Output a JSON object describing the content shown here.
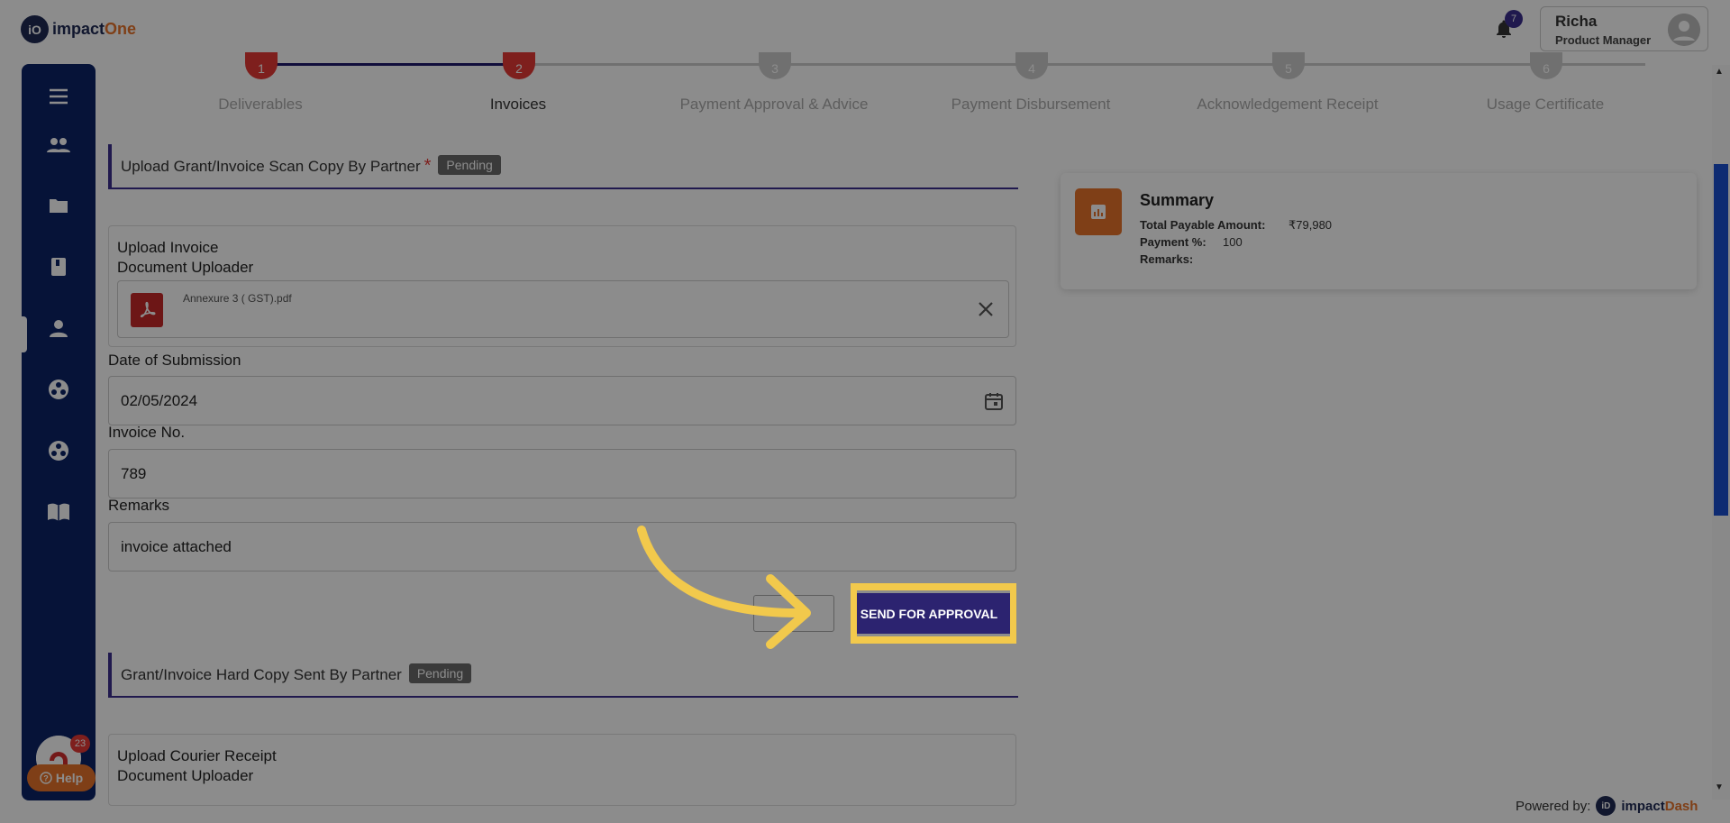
{
  "brand": {
    "logo_mark": "iO",
    "name_main": "impact",
    "name_accent": "One"
  },
  "header": {
    "notification_count": "7",
    "user_name": "Richa",
    "user_role": "Product Manager"
  },
  "sidebar": {
    "items": [
      {
        "icon": "menu-icon"
      },
      {
        "icon": "people-icon"
      },
      {
        "icon": "folder-icon"
      },
      {
        "icon": "book-icon"
      },
      {
        "icon": "person-icon"
      },
      {
        "icon": "group-circle-icon"
      },
      {
        "icon": "group-circle-icon"
      },
      {
        "icon": "open-book-icon"
      }
    ],
    "avatar_badge": "23",
    "help_label": "Help"
  },
  "stepper": {
    "steps": [
      {
        "number": "1",
        "label": "Deliverables"
      },
      {
        "number": "2",
        "label": "Invoices"
      },
      {
        "number": "3",
        "label": "Payment Approval & Advice"
      },
      {
        "number": "4",
        "label": "Payment Disbursement"
      },
      {
        "number": "5",
        "label": "Acknowledgement Receipt"
      },
      {
        "number": "6",
        "label": "Usage Certificate"
      }
    ],
    "active_index": 1
  },
  "section1": {
    "title": "Upload Grant/Invoice Scan Copy By Partner",
    "required_mark": "*",
    "status": "Pending",
    "uploader_title": "Upload Invoice",
    "uploader_subtitle": "Document Uploader",
    "file_name": "Annexure 3 ( GST).pdf",
    "date_label": "Date of Submission",
    "date_value": "02/05/2024",
    "invoice_label": "Invoice No.",
    "invoice_value": "789",
    "remarks_label": "Remarks",
    "remarks_value": "invoice attached",
    "send_button": "SEND FOR APPROVAL"
  },
  "section2": {
    "title": "Grant/Invoice Hard Copy Sent By Partner",
    "status": "Pending",
    "uploader_title": "Upload Courier Receipt",
    "uploader_subtitle": "Document Uploader"
  },
  "summary": {
    "title": "Summary",
    "total_label": "Total Payable Amount:",
    "total_value": "₹79,980",
    "payment_label": "Payment %:",
    "payment_value": "100",
    "remarks_label": "Remarks:"
  },
  "footer": {
    "powered_label": "Powered by:",
    "mark": "iD",
    "brand_main": "impact",
    "brand_accent": "Dash"
  },
  "colors": {
    "primary": "#2c2370",
    "accent": "#e8742a",
    "highlight": "#f2c94c",
    "sidebar": "#0b2366"
  }
}
